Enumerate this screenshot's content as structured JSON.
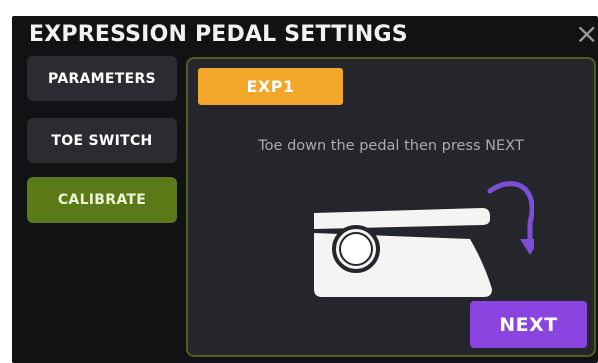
{
  "dialog": {
    "title": "EXPRESSION PEDAL SETTINGS",
    "close_icon": "close-icon"
  },
  "sidebar": {
    "items": [
      {
        "label": "PARAMETERS",
        "active": false
      },
      {
        "label": "TOE SWITCH",
        "active": false
      },
      {
        "label": "CALIBRATE",
        "active": true
      }
    ]
  },
  "panel": {
    "exp_tab": "EXP1",
    "instruction": "Toe down the pedal then press NEXT",
    "illustration_icon": "pedal-toe-down-icon",
    "next_label": "NEXT"
  },
  "colors": {
    "background": "#111214",
    "panel": "#24262c",
    "active_tab": "#5a7a18",
    "exp_tab": "#f2a72a",
    "next_button": "#8a44e0",
    "arrow": "#7e4fd6"
  }
}
